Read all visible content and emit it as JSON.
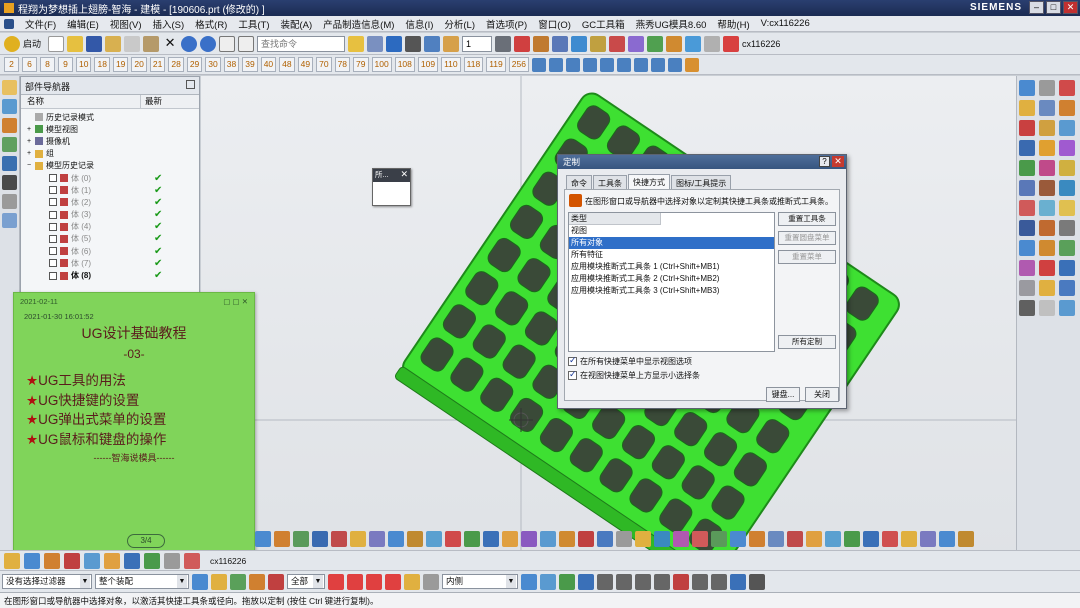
{
  "titlebar": {
    "title": "程翔为梦想插上翅膀-智海 - 建模 - [190606.prt  (修改的)  ]",
    "brand": "SIEMENS"
  },
  "menu": {
    "items": [
      "文件(F)",
      "编辑(E)",
      "视图(V)",
      "插入(S)",
      "格式(R)",
      "工具(T)",
      "装配(A)",
      "产品制造信息(M)",
      "信息(I)",
      "分析(L)",
      "首选项(P)",
      "窗口(O)",
      "GC工具箱",
      "燕秀UG模具8.60",
      "帮助(H)",
      "V:cx116226"
    ]
  },
  "toolbar1": {
    "start_label": "启动",
    "search_placeholder": "查找命令",
    "layer_value": "1",
    "user_label": "cx116226"
  },
  "toolbar2": {
    "numbers": [
      "2",
      "6",
      "8",
      "9",
      "10",
      "18",
      "19",
      "20",
      "21",
      "28",
      "29",
      "30",
      "38",
      "39",
      "40",
      "48",
      "49",
      "70",
      "78",
      "79",
      "100",
      "108",
      "109",
      "110",
      "118",
      "119",
      "256"
    ]
  },
  "navigator": {
    "title": "部件导航器",
    "col_name": "名称",
    "col_latest": "最新",
    "rows": [
      {
        "label": "历史记录模式",
        "level": 1,
        "check": false
      },
      {
        "label": "模型视图",
        "level": 1,
        "check": false
      },
      {
        "label": "摄像机",
        "level": 1,
        "check": false
      },
      {
        "label": "组",
        "level": 1,
        "check": false
      },
      {
        "label": "模型历史记录",
        "level": 1,
        "check": false
      },
      {
        "label": "体 (0)",
        "level": 2,
        "check": true
      },
      {
        "label": "体 (1)",
        "level": 2,
        "check": true
      },
      {
        "label": "体 (2)",
        "level": 2,
        "check": true
      },
      {
        "label": "体 (3)",
        "level": 2,
        "check": true
      },
      {
        "label": "体 (4)",
        "level": 2,
        "check": true
      },
      {
        "label": "体 (5)",
        "level": 2,
        "check": true
      },
      {
        "label": "体 (6)",
        "level": 2,
        "check": true
      },
      {
        "label": "体 (7)",
        "level": 2,
        "check": true
      },
      {
        "label": "体 (8)",
        "level": 2,
        "check": true
      }
    ],
    "check_mark": "✔"
  },
  "minidialog": {
    "title": "所..."
  },
  "dialog": {
    "title": "定制",
    "help": "?",
    "close": "✕",
    "tabs": [
      "命令",
      "工具条",
      "快捷方式",
      "图标/工具提示"
    ],
    "active_tab": "快捷方式",
    "hint": "在图形窗口或导航器中选择对象以定制其快捷工具条或推断式工具条。",
    "list_header": "类型",
    "list_items": [
      "视图",
      "所有对象",
      "所有特征",
      "应用模块推断式工具条 1 (Ctrl+Shift+MB1)",
      "应用模块推断式工具条 2 (Ctrl+Shift+MB2)",
      "应用模块推断式工具条 3 (Ctrl+Shift+MB3)"
    ],
    "selected_item": "所有对象",
    "buttons": {
      "reset_toolbar": "重置工具条",
      "reset_radial": "重置圆盘菜单",
      "reset_menu": "重置菜单",
      "all_custom": "所有定制",
      "keyboard": "键盘...",
      "close": "关闭"
    },
    "checkbox1": "在所有快捷菜单中显示视图选项",
    "checkbox2": "在视图快捷菜单上方显示小选择条"
  },
  "note": {
    "date": "2021-02-11",
    "timestamp": "2021-01-30  16:01:52",
    "title": "UG设计基础教程",
    "subtitle": "-03-",
    "items": [
      "UG工具的用法",
      "UG快捷键的设置",
      "UG弹出式菜单的设置",
      "UG鼠标和键盘的操作"
    ],
    "star": "★",
    "signature": "------智海说模具------",
    "page": "3/4"
  },
  "bottom": {
    "filter": "没有选择过滤器",
    "assembly": "整个装配",
    "scope": "全部",
    "inner": "内侧",
    "user": "cx116226"
  },
  "status": {
    "text": "在图形窗口或导航器中选择对象，以激活其快捷工具条或径向。拖放以定制 (按住 Ctrl 键进行复制)。"
  },
  "colors": {
    "model_green": "#3ee032",
    "note_green": "#80d45a",
    "selection_blue": "#2f6fc8"
  }
}
